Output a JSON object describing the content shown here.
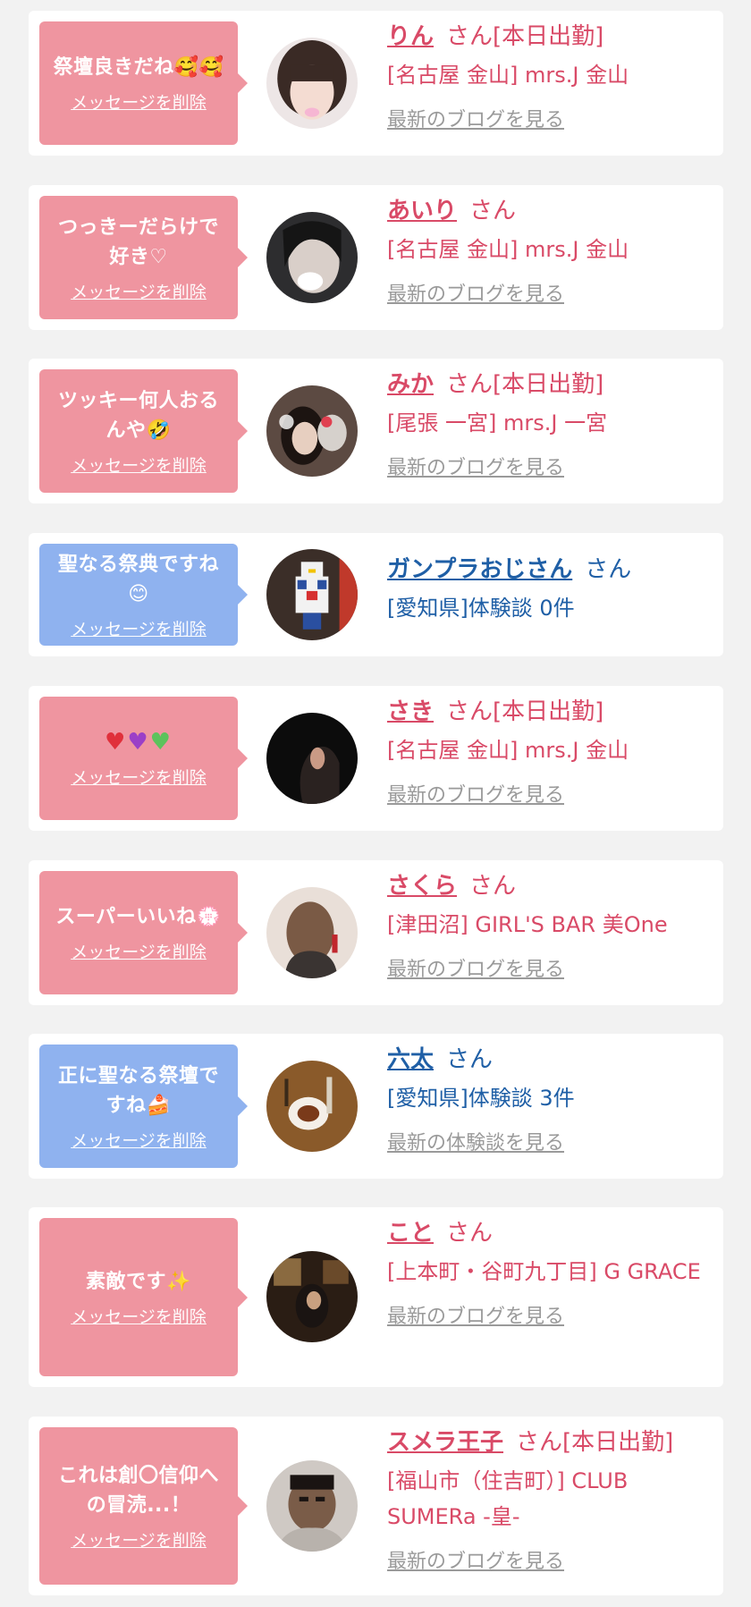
{
  "delete_label": "メッセージを削除",
  "san": "さん",
  "blog_label": "最新のブログを見る",
  "review_label": "最新の体験談を見る",
  "items": [
    {
      "message": "祭壇良きだね🥰🥰",
      "name": "りん",
      "status": "[本日出勤]",
      "shop": "[名古屋 金山] mrs.J 金山"
    },
    {
      "message": "つっきーだらけで好き♡",
      "name": "あいり",
      "status": "",
      "shop": "[名古屋 金山] mrs.J 金山"
    },
    {
      "message": "ツッキー何人おるんや🤣",
      "name": "みか",
      "status": "[本日出勤]",
      "shop": "[尾張 一宮] mrs.J 一宮"
    },
    {
      "message": "聖なる祭典ですね😊",
      "name": "ガンプラおじさん",
      "status": "",
      "shop": "[愛知県]体験談 0件"
    },
    {
      "message": "",
      "name": "さき",
      "status": "[本日出勤]",
      "shop": "[名古屋 金山] mrs.J 金山"
    },
    {
      "message": "スーパーいいね💮",
      "name": "さくら",
      "status": "",
      "shop": "[津田沼] GIRL'S BAR 美One"
    },
    {
      "message": "正に聖なる祭壇ですね🍰",
      "name": "六太",
      "status": "",
      "shop": "[愛知県]体験談 3件"
    },
    {
      "message": "素敵です✨",
      "name": "こと",
      "status": "",
      "shop": "[上本町・谷町九丁目] G GRACE"
    },
    {
      "message": "これは創〇信仰への冒涜...！",
      "name": "スメラ王子",
      "status": "[本日出勤]",
      "shop": "[福山市（住吉町）] CLUB SUMERa -皇-"
    }
  ]
}
